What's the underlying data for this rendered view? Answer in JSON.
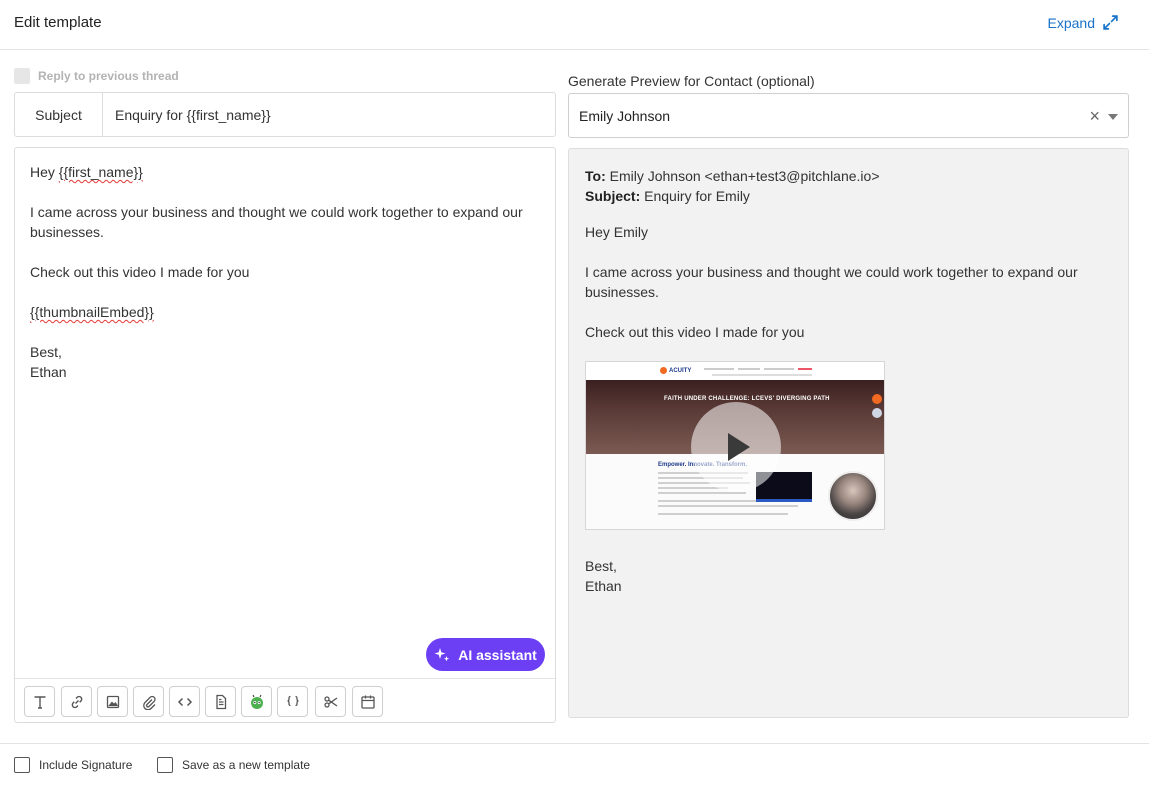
{
  "header": {
    "title": "Edit template",
    "expand_label": "Expand"
  },
  "reply": {
    "label": "Reply to previous thread",
    "checked": false
  },
  "subject": {
    "label": "Subject",
    "value": "Enquiry for {{first_name}}"
  },
  "editor": {
    "greeting_prefix": "Hey ",
    "greeting_var": "{{first_name}}",
    "para1_line1": "I came across your business and thought we could work together to expand our",
    "para1_line2": "businesses.",
    "para2": "Check out this video I made for you",
    "embed_var": "{{thumbnailEmbed}}",
    "signoff": "Best,",
    "signer": "Ethan"
  },
  "ai_button": {
    "label": "AI assistant"
  },
  "toolbar": {
    "tools": [
      "text-format",
      "insert-link",
      "insert-image",
      "attach-file",
      "code-view",
      "template-doc",
      "robot",
      "variables",
      "snippets",
      "calendar"
    ]
  },
  "preview": {
    "section_label": "Generate Preview for Contact (optional)",
    "selected_contact": "Emily Johnson",
    "clear_symbol": "×",
    "to_label": "To:",
    "to_value": " Emily Johnson <ethan+test3@pitchlane.io>",
    "subject_label": "Subject:",
    "subject_value": " Enquiry for Emily",
    "greeting": "Hey Emily",
    "para1_line1": "I came across your business and thought we could work together to expand our",
    "para1_line2": "businesses.",
    "para2": "Check out this video I made for you",
    "signoff": "Best,",
    "signer": "Ethan",
    "thumbnail": {
      "logo_text": "ACUITY",
      "hero_title": "FAITH UNDER CHALLENGE: LCEVS' DIVERGING PATH",
      "content_title": "Empower. Innovate. Transform."
    }
  },
  "footer": {
    "include_signature_label": "Include Signature",
    "include_signature_checked": false,
    "save_template_label": "Save as a new template",
    "save_template_checked": false
  },
  "colors": {
    "accent_blue": "#1a73c9",
    "ai_purple": "#6c3ff5",
    "preview_bg": "#f2f2f2"
  }
}
